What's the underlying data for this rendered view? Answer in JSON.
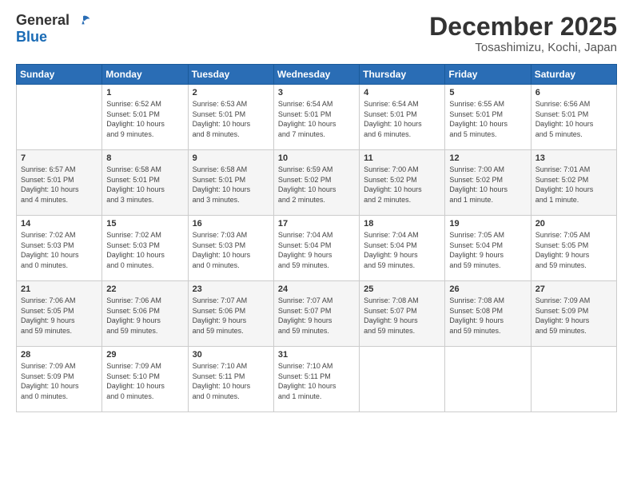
{
  "header": {
    "logo_general": "General",
    "logo_blue": "Blue",
    "month_title": "December 2025",
    "location": "Tosashimizu, Kochi, Japan"
  },
  "days_of_week": [
    "Sunday",
    "Monday",
    "Tuesday",
    "Wednesday",
    "Thursday",
    "Friday",
    "Saturday"
  ],
  "weeks": [
    [
      {
        "day": "",
        "info": ""
      },
      {
        "day": "1",
        "info": "Sunrise: 6:52 AM\nSunset: 5:01 PM\nDaylight: 10 hours\nand 9 minutes."
      },
      {
        "day": "2",
        "info": "Sunrise: 6:53 AM\nSunset: 5:01 PM\nDaylight: 10 hours\nand 8 minutes."
      },
      {
        "day": "3",
        "info": "Sunrise: 6:54 AM\nSunset: 5:01 PM\nDaylight: 10 hours\nand 7 minutes."
      },
      {
        "day": "4",
        "info": "Sunrise: 6:54 AM\nSunset: 5:01 PM\nDaylight: 10 hours\nand 6 minutes."
      },
      {
        "day": "5",
        "info": "Sunrise: 6:55 AM\nSunset: 5:01 PM\nDaylight: 10 hours\nand 5 minutes."
      },
      {
        "day": "6",
        "info": "Sunrise: 6:56 AM\nSunset: 5:01 PM\nDaylight: 10 hours\nand 5 minutes."
      }
    ],
    [
      {
        "day": "7",
        "info": "Sunrise: 6:57 AM\nSunset: 5:01 PM\nDaylight: 10 hours\nand 4 minutes."
      },
      {
        "day": "8",
        "info": "Sunrise: 6:58 AM\nSunset: 5:01 PM\nDaylight: 10 hours\nand 3 minutes."
      },
      {
        "day": "9",
        "info": "Sunrise: 6:58 AM\nSunset: 5:01 PM\nDaylight: 10 hours\nand 3 minutes."
      },
      {
        "day": "10",
        "info": "Sunrise: 6:59 AM\nSunset: 5:02 PM\nDaylight: 10 hours\nand 2 minutes."
      },
      {
        "day": "11",
        "info": "Sunrise: 7:00 AM\nSunset: 5:02 PM\nDaylight: 10 hours\nand 2 minutes."
      },
      {
        "day": "12",
        "info": "Sunrise: 7:00 AM\nSunset: 5:02 PM\nDaylight: 10 hours\nand 1 minute."
      },
      {
        "day": "13",
        "info": "Sunrise: 7:01 AM\nSunset: 5:02 PM\nDaylight: 10 hours\nand 1 minute."
      }
    ],
    [
      {
        "day": "14",
        "info": "Sunrise: 7:02 AM\nSunset: 5:03 PM\nDaylight: 10 hours\nand 0 minutes."
      },
      {
        "day": "15",
        "info": "Sunrise: 7:02 AM\nSunset: 5:03 PM\nDaylight: 10 hours\nand 0 minutes."
      },
      {
        "day": "16",
        "info": "Sunrise: 7:03 AM\nSunset: 5:03 PM\nDaylight: 10 hours\nand 0 minutes."
      },
      {
        "day": "17",
        "info": "Sunrise: 7:04 AM\nSunset: 5:04 PM\nDaylight: 9 hours\nand 59 minutes."
      },
      {
        "day": "18",
        "info": "Sunrise: 7:04 AM\nSunset: 5:04 PM\nDaylight: 9 hours\nand 59 minutes."
      },
      {
        "day": "19",
        "info": "Sunrise: 7:05 AM\nSunset: 5:04 PM\nDaylight: 9 hours\nand 59 minutes."
      },
      {
        "day": "20",
        "info": "Sunrise: 7:05 AM\nSunset: 5:05 PM\nDaylight: 9 hours\nand 59 minutes."
      }
    ],
    [
      {
        "day": "21",
        "info": "Sunrise: 7:06 AM\nSunset: 5:05 PM\nDaylight: 9 hours\nand 59 minutes."
      },
      {
        "day": "22",
        "info": "Sunrise: 7:06 AM\nSunset: 5:06 PM\nDaylight: 9 hours\nand 59 minutes."
      },
      {
        "day": "23",
        "info": "Sunrise: 7:07 AM\nSunset: 5:06 PM\nDaylight: 9 hours\nand 59 minutes."
      },
      {
        "day": "24",
        "info": "Sunrise: 7:07 AM\nSunset: 5:07 PM\nDaylight: 9 hours\nand 59 minutes."
      },
      {
        "day": "25",
        "info": "Sunrise: 7:08 AM\nSunset: 5:07 PM\nDaylight: 9 hours\nand 59 minutes."
      },
      {
        "day": "26",
        "info": "Sunrise: 7:08 AM\nSunset: 5:08 PM\nDaylight: 9 hours\nand 59 minutes."
      },
      {
        "day": "27",
        "info": "Sunrise: 7:09 AM\nSunset: 5:09 PM\nDaylight: 9 hours\nand 59 minutes."
      }
    ],
    [
      {
        "day": "28",
        "info": "Sunrise: 7:09 AM\nSunset: 5:09 PM\nDaylight: 10 hours\nand 0 minutes."
      },
      {
        "day": "29",
        "info": "Sunrise: 7:09 AM\nSunset: 5:10 PM\nDaylight: 10 hours\nand 0 minutes."
      },
      {
        "day": "30",
        "info": "Sunrise: 7:10 AM\nSunset: 5:11 PM\nDaylight: 10 hours\nand 0 minutes."
      },
      {
        "day": "31",
        "info": "Sunrise: 7:10 AM\nSunset: 5:11 PM\nDaylight: 10 hours\nand 1 minute."
      },
      {
        "day": "",
        "info": ""
      },
      {
        "day": "",
        "info": ""
      },
      {
        "day": "",
        "info": ""
      }
    ]
  ]
}
